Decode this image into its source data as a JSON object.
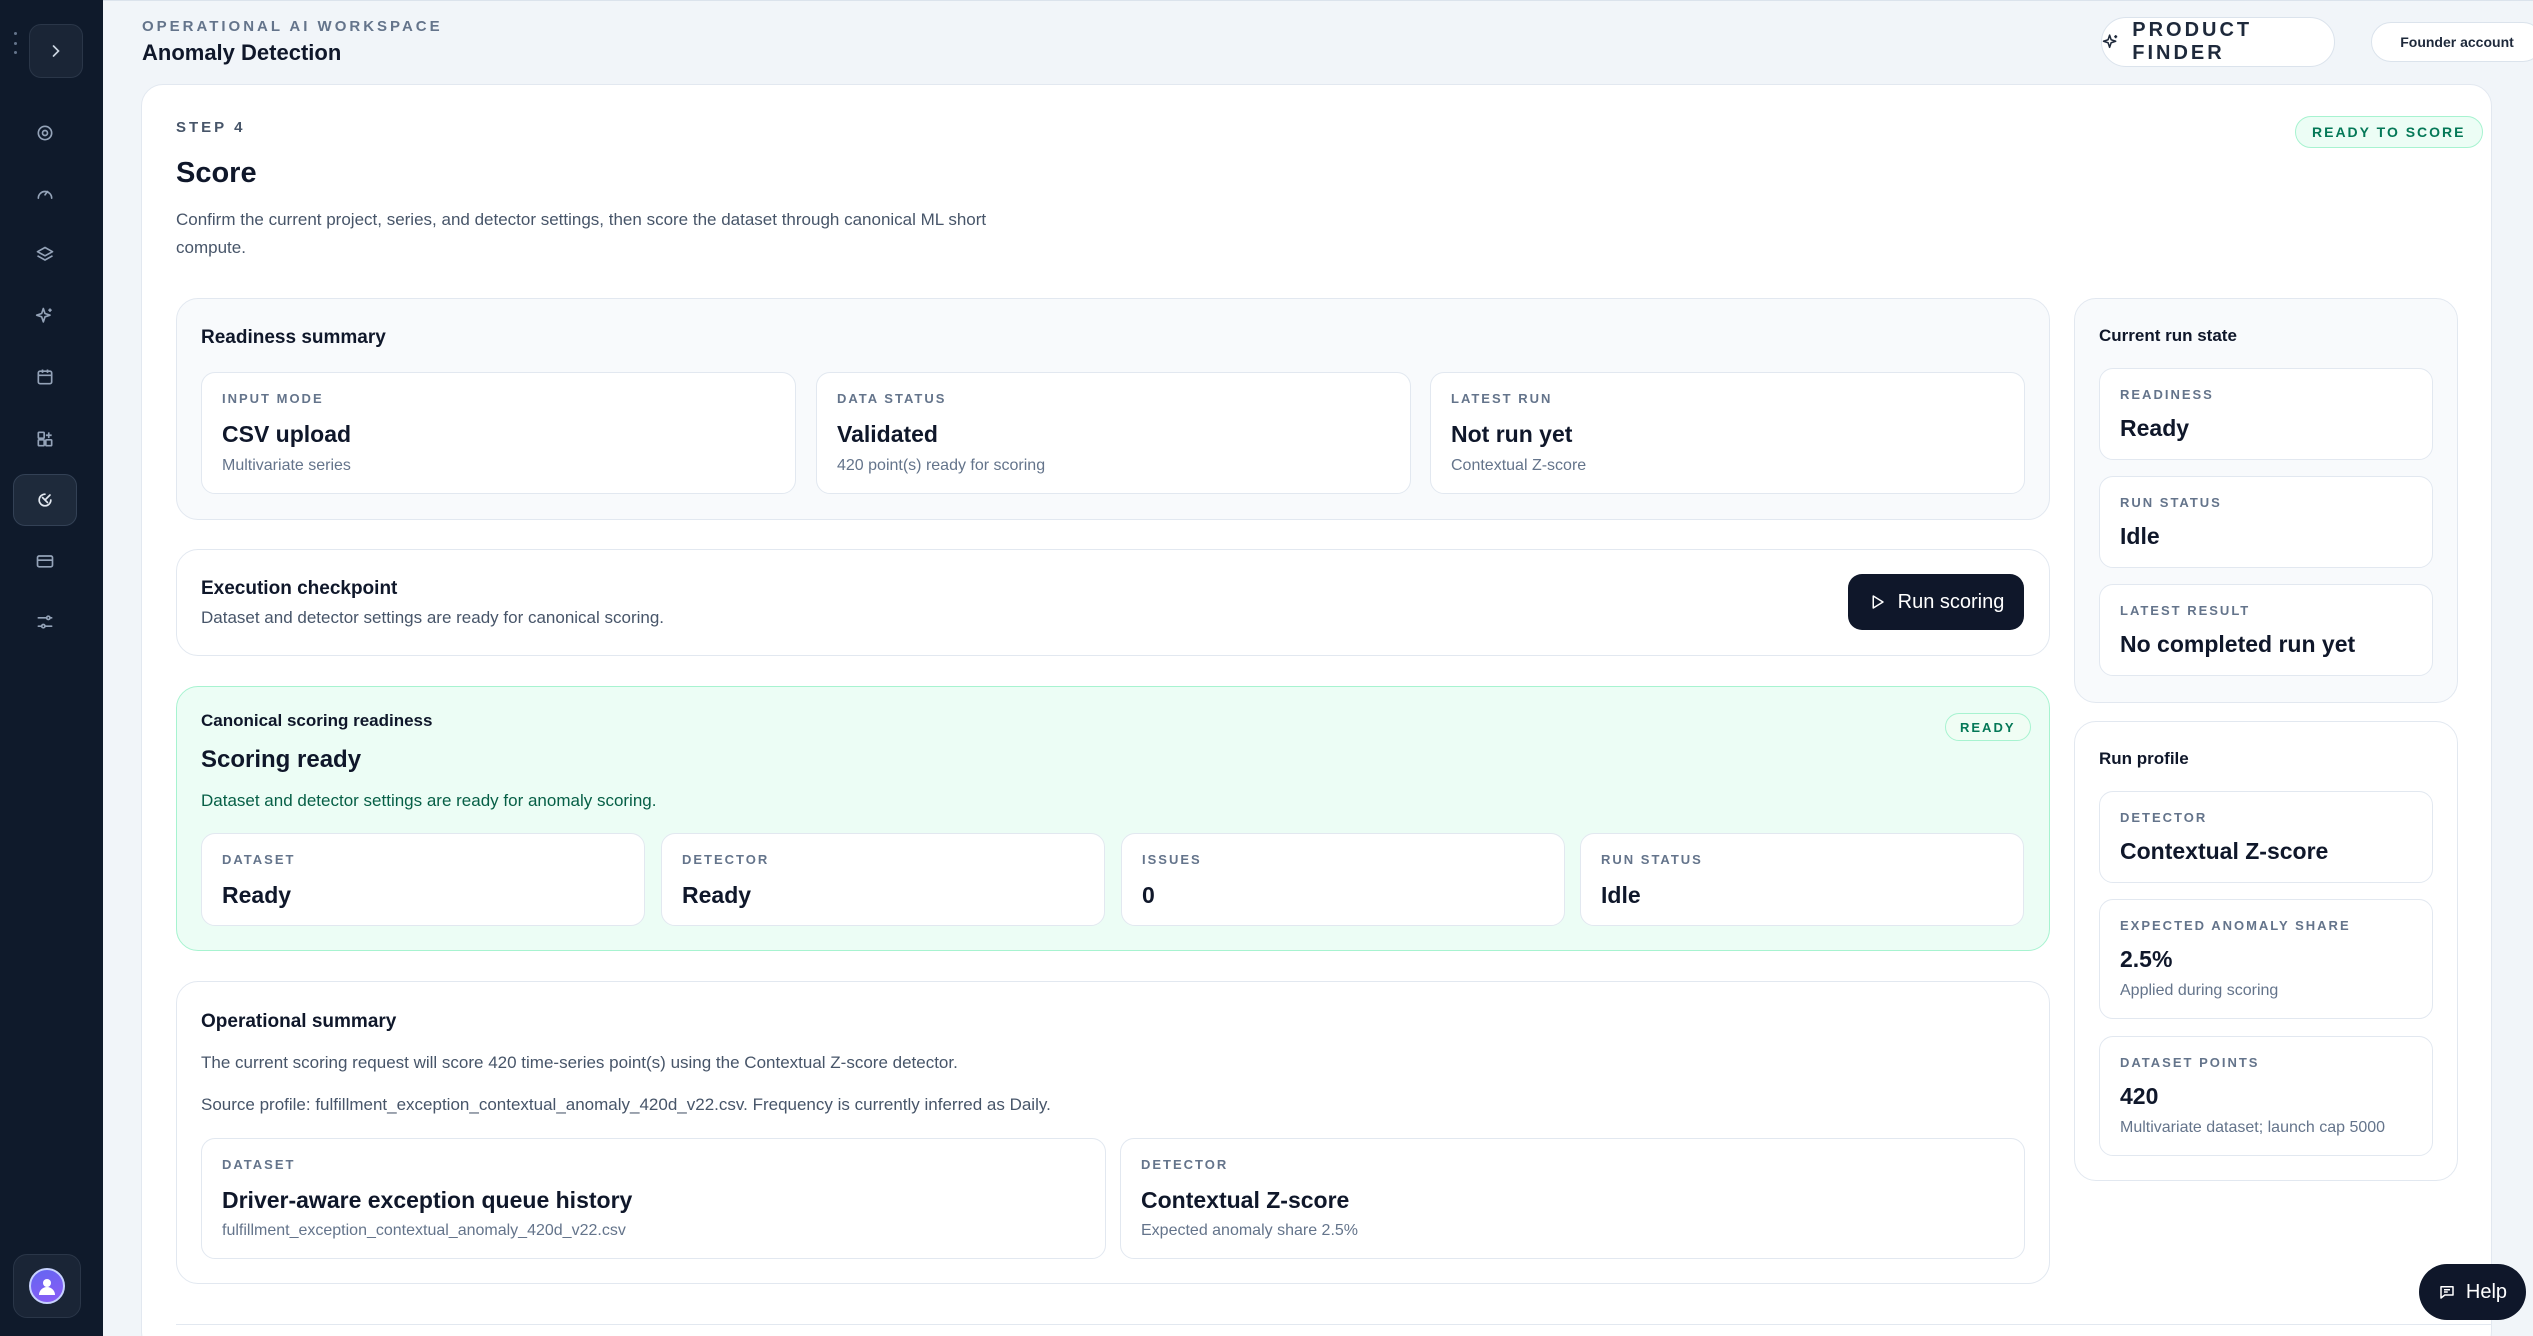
{
  "header": {
    "eyebrow": "OPERATIONAL AI WORKSPACE",
    "title": "Anomaly Detection",
    "product_finder": "PRODUCT FINDER",
    "account": "Founder account"
  },
  "sidebar": {
    "items": [
      {
        "icon": "gear-icon"
      },
      {
        "icon": "gauge-icon"
      },
      {
        "icon": "layers-icon"
      },
      {
        "icon": "sparkle-icon"
      },
      {
        "icon": "calendar-icon"
      },
      {
        "icon": "apps-icon"
      },
      {
        "icon": "anomaly-icon",
        "active": true
      },
      {
        "icon": "card-icon"
      },
      {
        "icon": "sliders-icon"
      }
    ]
  },
  "step": {
    "eyebrow": "STEP 4",
    "title": "Score",
    "description": "Confirm the current project, series, and detector settings, then score the dataset through canonical ML short compute.",
    "badge": "READY TO SCORE"
  },
  "readiness": {
    "title": "Readiness summary",
    "tiles": [
      {
        "label": "INPUT MODE",
        "value": "CSV upload",
        "sub": "Multivariate series"
      },
      {
        "label": "DATA STATUS",
        "value": "Validated",
        "sub": "420 point(s) ready for scoring"
      },
      {
        "label": "LATEST RUN",
        "value": "Not run yet",
        "sub": "Contextual Z-score"
      }
    ]
  },
  "checkpoint": {
    "title": "Execution checkpoint",
    "sub": "Dataset and detector settings are ready for canonical scoring.",
    "button": "Run scoring"
  },
  "canonical": {
    "eyebrow": "Canonical scoring readiness",
    "title": "Scoring ready",
    "sub": "Dataset and detector settings are ready for anomaly scoring.",
    "badge": "READY",
    "tiles": [
      {
        "label": "DATASET",
        "value": "Ready"
      },
      {
        "label": "DETECTOR",
        "value": "Ready"
      },
      {
        "label": "ISSUES",
        "value": "0"
      },
      {
        "label": "RUN STATUS",
        "value": "Idle"
      }
    ]
  },
  "operational": {
    "title": "Operational summary",
    "line1": "The current scoring request will score 420 time-series point(s) using the Contextual Z-score detector.",
    "line2": "Source profile: fulfillment_exception_contextual_anomaly_420d_v22.csv. Frequency is currently inferred as Daily.",
    "tiles": [
      {
        "label": "DATASET",
        "value": "Driver-aware exception queue history",
        "sub": "fulfillment_exception_contextual_anomaly_420d_v22.csv"
      },
      {
        "label": "DETECTOR",
        "value": "Contextual Z-score",
        "sub": "Expected anomaly share 2.5%"
      }
    ]
  },
  "run_state": {
    "title": "Current run state",
    "tiles": [
      {
        "label": "READINESS",
        "value": "Ready"
      },
      {
        "label": "RUN STATUS",
        "value": "Idle"
      },
      {
        "label": "LATEST RESULT",
        "value": "No completed run yet"
      }
    ]
  },
  "run_profile": {
    "title": "Run profile",
    "tiles": [
      {
        "label": "DETECTOR",
        "value": "Contextual Z-score"
      },
      {
        "label": "EXPECTED ANOMALY SHARE",
        "value": "2.5%",
        "sub": "Applied during scoring"
      },
      {
        "label": "DATASET POINTS",
        "value": "420",
        "sub": "Multivariate dataset; launch cap 5000"
      }
    ]
  },
  "help": "Help",
  "colors": {
    "sidebar": "#0f1a2b",
    "accent_green": "#047857",
    "dark_button": "#0f172a"
  }
}
